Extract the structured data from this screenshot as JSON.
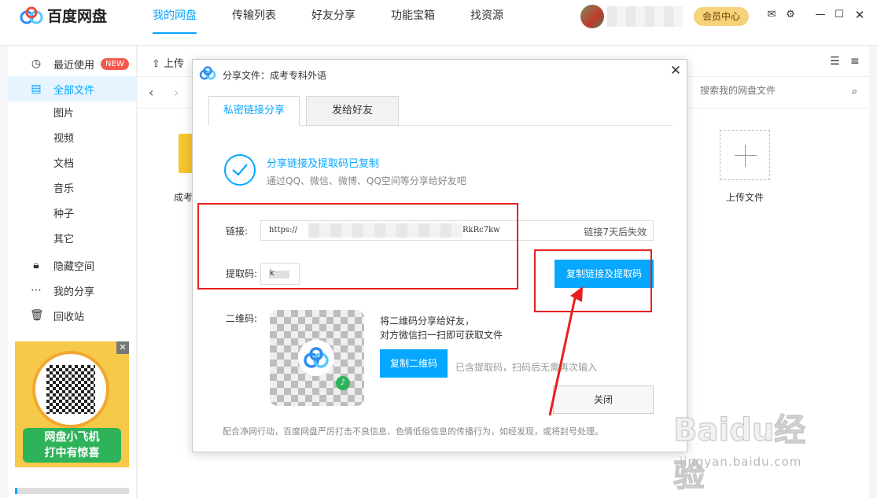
{
  "app": {
    "title": "百度网盘",
    "nav": [
      "我的网盘",
      "传输列表",
      "好友分享",
      "功能宝箱",
      "找资源"
    ],
    "vip": "会员中心"
  },
  "sidebar": {
    "items": [
      {
        "label": "最近使用",
        "badge": "NEW",
        "icon": "clock-icon"
      },
      {
        "label": "全部文件",
        "icon": "file-icon"
      },
      {
        "label": "图片"
      },
      {
        "label": "视频"
      },
      {
        "label": "文档"
      },
      {
        "label": "音乐"
      },
      {
        "label": "种子"
      },
      {
        "label": "其它"
      },
      {
        "label": "隐藏空间",
        "icon": "lock-icon"
      },
      {
        "label": "我的分享",
        "icon": "share-icon"
      },
      {
        "label": "回收站",
        "icon": "trash-icon"
      }
    ],
    "ad": {
      "line1": "网盘小飞机",
      "line2": "打中有惊喜"
    }
  },
  "main": {
    "toolbar": {
      "upload": "上传"
    },
    "search_placeholder": "搜索我的网盘文件",
    "folder_name": "成考",
    "upload_tile_label": "上传文件"
  },
  "dialog": {
    "title": "分享文件：成考专科外语",
    "tabs": [
      "私密链接分享",
      "发给好友"
    ],
    "copied_title": "分享链接及提取码已复制",
    "copied_sub": "通过QQ、微信、微博、QQ空间等分享给好友吧",
    "link_label": "链接:",
    "link_prefix": "https://",
    "link_suffix": "RkRc7kw",
    "link_expire": "链接7天后失效",
    "code_label": "提取码:",
    "code_value": "k",
    "copy_link_button": "复制链接及提取码",
    "qr_label": "二维码:",
    "qr_hint_line1": "将二维码分享给好友，",
    "qr_hint_line2": "对方微信扫一扫即可获取文件",
    "copy_qr_button": "复制二维码",
    "qr_note": "已含提取码，扫码后无需再次输入",
    "close_button": "关闭",
    "footer": "配合净网行动，百度网盘严厉打击不良信息、色情低俗信息的传播行为，如经发现，或将封号处理。"
  },
  "watermark": {
    "brand": "Baidu经验",
    "url": "jingyan.baidu.com"
  },
  "colors": {
    "accent": "#06a7ff",
    "annotation_red": "#e7201f",
    "badge_red": "#f5584a"
  }
}
